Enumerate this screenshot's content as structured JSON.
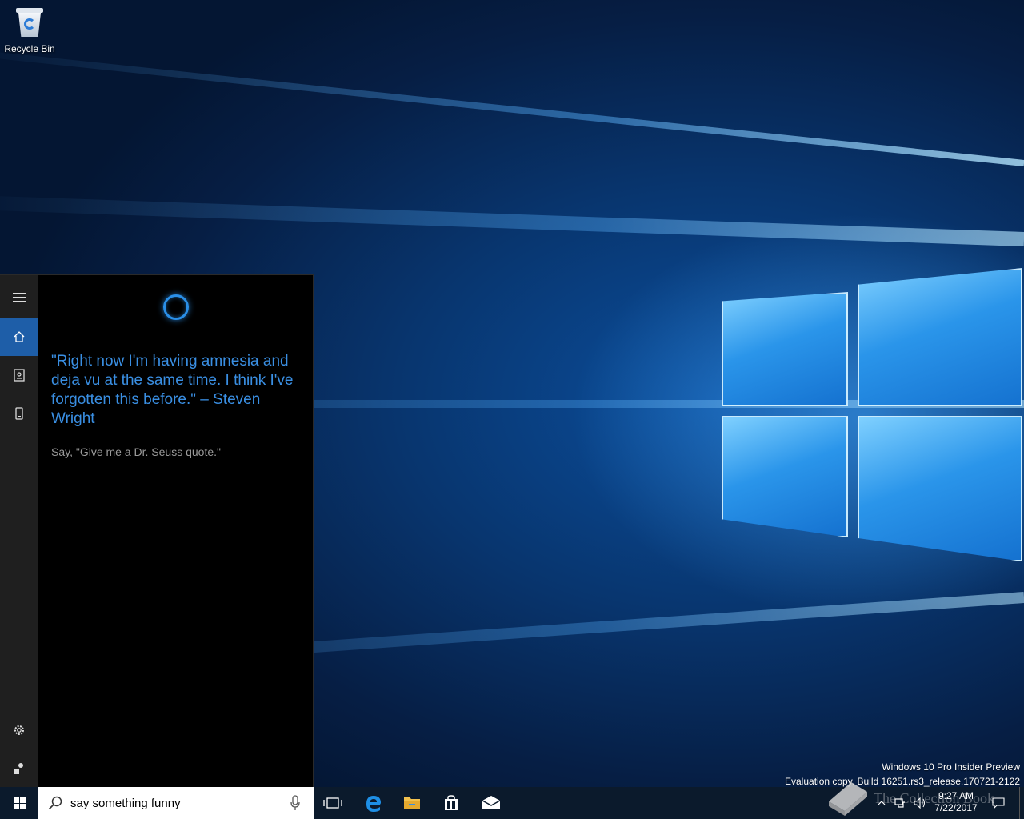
{
  "desktop": {
    "icons": [
      {
        "label": "Recycle Bin",
        "icon": "recycle-bin-icon"
      }
    ],
    "build_info": {
      "line1": "Windows 10 Pro Insider Preview",
      "line2": "Evaluation copy. Build 16251.rs3_release.170721-2122"
    }
  },
  "cortana": {
    "rail": [
      {
        "name": "menu",
        "icon": "hamburger-icon"
      },
      {
        "name": "home",
        "icon": "home-icon",
        "active": true
      },
      {
        "name": "notebook",
        "icon": "notebook-icon"
      },
      {
        "name": "devices",
        "icon": "device-icon"
      },
      {
        "name": "settings",
        "icon": "gear-icon"
      },
      {
        "name": "feedback",
        "icon": "feedback-icon"
      }
    ],
    "quote": "\"Right now I'm having amnesia and deja vu at the same time. I think I've forgotten this before.\" – Steven Wright",
    "hint": "Say, \"Give me a Dr. Seuss quote.\"",
    "accent": "#3a8fe3"
  },
  "taskbar": {
    "search_value": "say something funny",
    "apps": [
      {
        "name": "task-view",
        "icon": "task-view-icon"
      },
      {
        "name": "edge",
        "icon": "edge-icon"
      },
      {
        "name": "file-explorer",
        "icon": "folder-icon"
      },
      {
        "name": "store",
        "icon": "store-icon"
      },
      {
        "name": "mail",
        "icon": "mail-icon"
      }
    ],
    "clock": {
      "time": "9:27 AM",
      "date": "7/22/2017"
    },
    "watermark": "The Collection Book"
  }
}
